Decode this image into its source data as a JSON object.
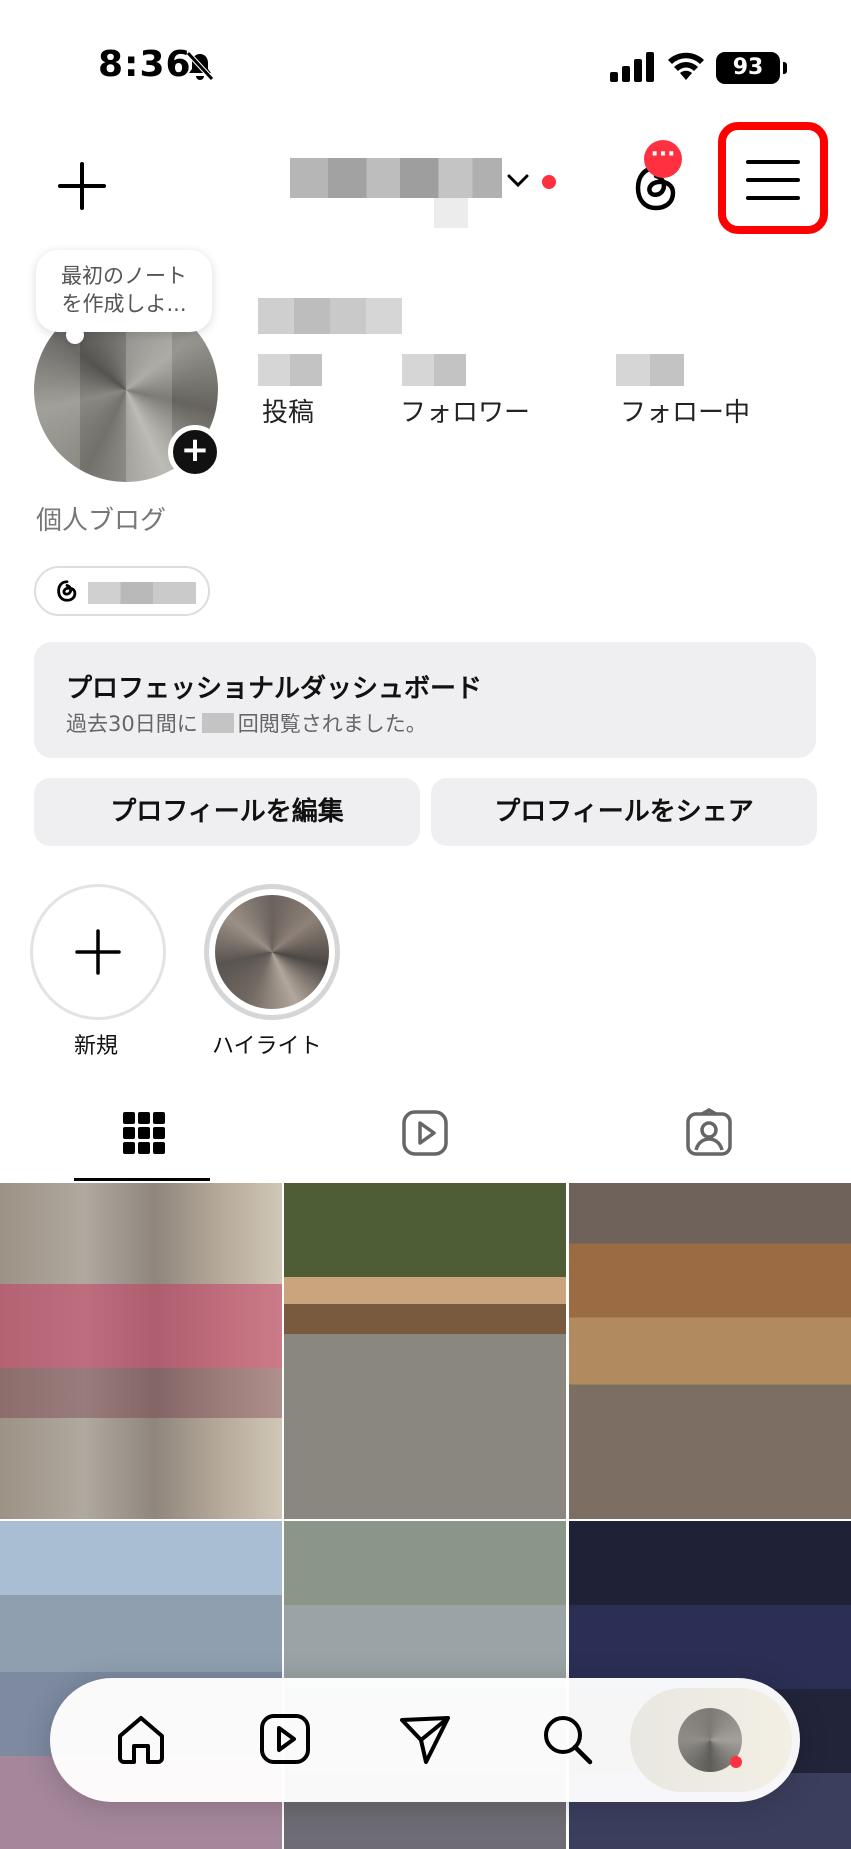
{
  "status_bar": {
    "time": "8:36",
    "battery": "93"
  },
  "threads_badge": "···",
  "note": {
    "text": "最初のノートを作成しよ..."
  },
  "stats": [
    {
      "label": "投稿"
    },
    {
      "label": "フォロワー"
    },
    {
      "label": "フォロー中"
    }
  ],
  "bio": {
    "category": "個人ブログ"
  },
  "dashboard": {
    "title": "プロフェッショナルダッシュボード",
    "subtitle_prefix": "過去30日間に",
    "subtitle_suffix": "回閲覧されました。"
  },
  "buttons": {
    "edit": "プロフィールを編集",
    "share": "プロフィールをシェア"
  },
  "highlights": [
    {
      "label": "新規"
    },
    {
      "label": "ハイライト"
    }
  ],
  "colors": {
    "accent_red": "#ff3040",
    "highlight_frame": "#ff0000",
    "button_bg": "#efeff1"
  }
}
